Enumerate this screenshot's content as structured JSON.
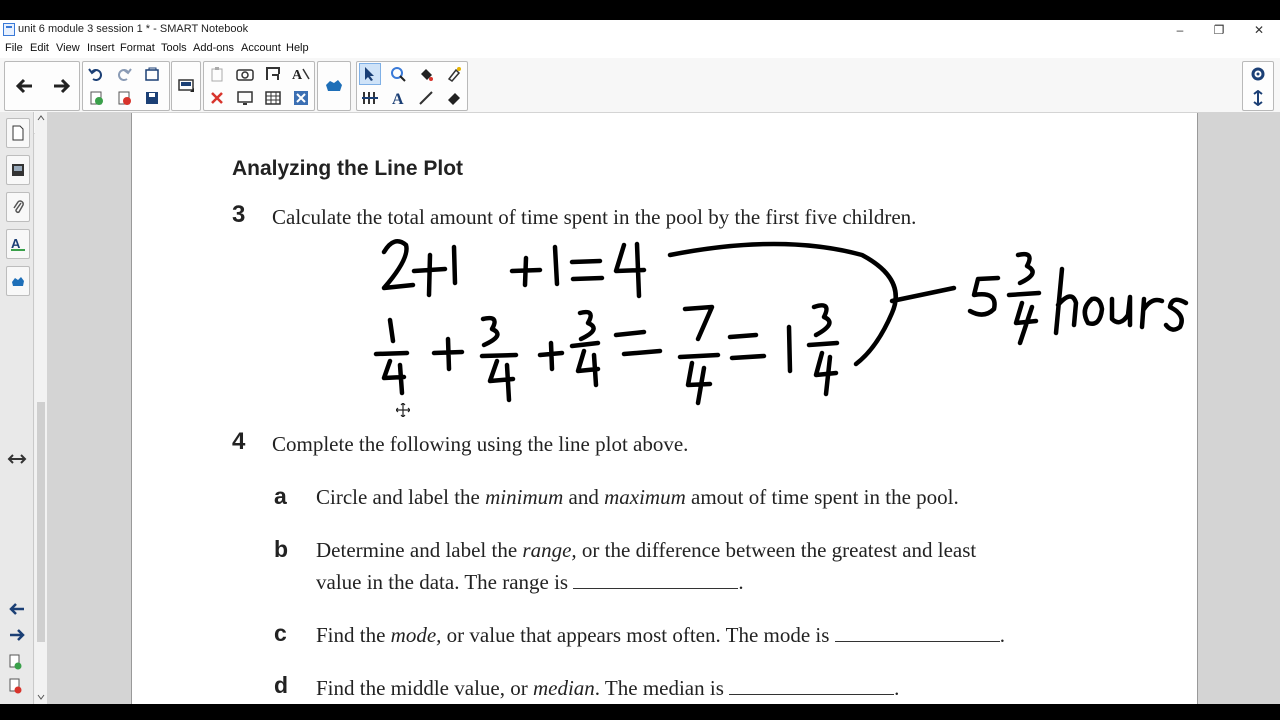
{
  "window": {
    "title": "unit 6 module 3 session 1 * - SMART Notebook",
    "minimize": "–",
    "restore": "❐",
    "close": "✕"
  },
  "menu": [
    "File",
    "Edit",
    "View",
    "Insert",
    "Format",
    "Tools",
    "Add-ons",
    "Account",
    "Help"
  ],
  "icons": {
    "toolbar": [
      "back-icon",
      "forward-icon",
      "undo-icon",
      "redo-icon",
      "add-page-icon",
      "delete-page-icon",
      "save-icon",
      "screen-shade-icon",
      "paste-icon",
      "delete-icon",
      "screenshot-icon",
      "full-screen-icon",
      "table-icon",
      "clear-ink-icon",
      "dual-page-icon",
      "select-icon",
      "pens-icon",
      "fill-icon",
      "eraser-icon",
      "shapes-icon",
      "text-icon",
      "lines-icon",
      "settings-icon",
      "move-toolbar-icon"
    ],
    "sidebar": [
      "page-sorter-icon",
      "gallery-icon",
      "attachments-icon",
      "properties-icon",
      "add-ons-icon",
      "resize-arrows-icon",
      "prev-page-icon",
      "next-page-icon",
      "add-page-icon",
      "delete-page-icon"
    ]
  },
  "worksheet": {
    "heading": "Analyzing the Line Plot",
    "q3": {
      "num": "3",
      "text": "Calculate the total amount of time spent in the pool by the first five children."
    },
    "q4": {
      "num": "4",
      "text": "Complete the following using the line plot above."
    },
    "items": [
      {
        "letter": "a",
        "before": "Circle and label the ",
        "em1": "minimum",
        "mid": " and ",
        "em2": "maximum",
        "after": " amout of time spent in the pool."
      },
      {
        "letter": "b",
        "before": "Determine and label the ",
        "em1": "range,",
        "after": " or the difference between the greatest and least",
        "line2": "value in the data. The range is",
        "end": "."
      },
      {
        "letter": "c",
        "before": "Find the ",
        "em1": "mode,",
        "after": " or value that appears most often. The mode is",
        "end": "."
      },
      {
        "letter": "d",
        "before": "Find the middle value, or ",
        "em1": "median",
        "after": ". The median is",
        "end": "."
      }
    ]
  },
  "handwriting": {
    "line1": "2+1 +1=4",
    "line2": "1/4 + 3/4 + 3/4 = 7/4 = 1 3/4",
    "answer": "5 3/4 hours"
  },
  "colors": {
    "accent": "#1f5fbf",
    "ink": "#000000"
  }
}
